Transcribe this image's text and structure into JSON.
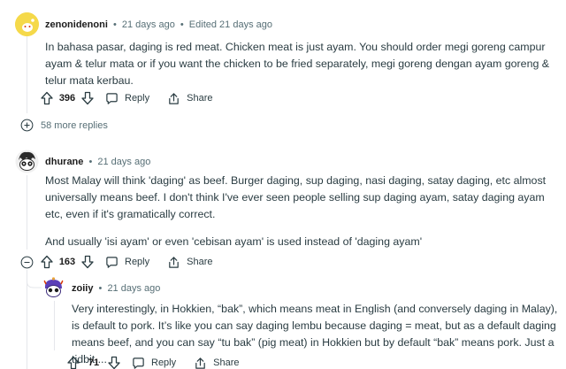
{
  "comments": [
    {
      "author": "zenonidenoni",
      "time": "21 days ago",
      "edited": "Edited 21 days ago",
      "body": "In bahasa pasar, daging is red meat. Chicken meat is just ayam. You should order megi goreng campur ayam & telur mata or if you want the chicken to be fried separately, megi goreng dengan ayam goreng & telur mata kerbau.",
      "votes": "396",
      "reply_label": "Reply",
      "share_label": "Share",
      "more_replies": "58 more replies"
    },
    {
      "author": "dhurane",
      "time": "21 days ago",
      "body_p1": "Most Malay will think 'daging' as beef. Burger daging, sup daging, nasi daging, satay daging, etc almost universally means beef. I don't think I've ever seen people selling sup daging ayam, satay daging ayam etc, even if it's gramatically correct.",
      "body_p2": "And usually 'isi ayam' or even 'cebisan ayam' is used instead of 'daging ayam'",
      "votes": "163",
      "reply_label": "Reply",
      "share_label": "Share"
    },
    {
      "author": "zoiiy",
      "time": "21 days ago",
      "body": "Very interestingly, in Hokkien, “bak”, which means meat in English (and conversely daging in Malay), is default to pork. It’s like you can say daging lembu because daging = meat, but as a default daging means beef, and you can say “tu bak” (pig meat) in Hokkien but by default “bak” means pork. Just a tidbit....",
      "votes": "71",
      "reply_label": "Reply",
      "share_label": "Share"
    }
  ],
  "separator": "•",
  "icons": [
    "upvote-icon",
    "downvote-icon",
    "reply-icon",
    "share-icon",
    "expand-icon",
    "collapse-icon"
  ],
  "colors": {
    "meta": "#576f76",
    "text": "#2a3c42",
    "line": "#e5e7eb",
    "avatar1": "#f5d94a"
  }
}
